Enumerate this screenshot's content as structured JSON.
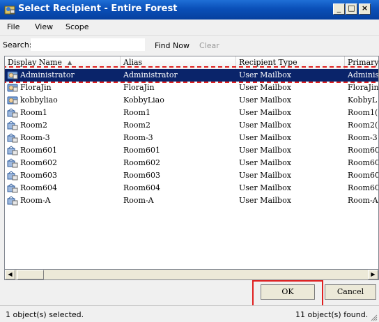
{
  "window": {
    "title": "Select Recipient - Entire Forest",
    "minimize_label": "_",
    "maximize_label": "□",
    "close_label": "×"
  },
  "menu": {
    "items": [
      "File",
      "View",
      "Scope"
    ]
  },
  "search": {
    "label": "Search:",
    "value": "",
    "find_now": "Find Now",
    "clear": "Clear"
  },
  "columns": [
    "Display Name",
    "Alias",
    "Recipient Type",
    "Primary"
  ],
  "rows": [
    {
      "display_name": "Administrator",
      "alias": "Administrator",
      "type": "User Mailbox",
      "primary": "Adminis",
      "icon": "user-mailbox-icon",
      "selected": true
    },
    {
      "display_name": "FloraJin",
      "alias": "FloraJin",
      "type": "User Mailbox",
      "primary": "FloraJin",
      "icon": "user-mailbox-icon"
    },
    {
      "display_name": "kobbyliao",
      "alias": "KobbyLiao",
      "type": "User Mailbox",
      "primary": "KobbyL",
      "icon": "user-mailbox-icon"
    },
    {
      "display_name": "Room1",
      "alias": "Room1",
      "type": "User Mailbox",
      "primary": "Room1(",
      "icon": "room-mailbox-icon"
    },
    {
      "display_name": "Room2",
      "alias": "Room2",
      "type": "User Mailbox",
      "primary": "Room2(",
      "icon": "room-mailbox-icon"
    },
    {
      "display_name": "Room-3",
      "alias": "Room-3",
      "type": "User Mailbox",
      "primary": "Room-3",
      "icon": "room-mailbox-icon"
    },
    {
      "display_name": "Room601",
      "alias": "Room601",
      "type": "User Mailbox",
      "primary": "Room60",
      "icon": "room-mailbox-icon"
    },
    {
      "display_name": "Room602",
      "alias": "Room602",
      "type": "User Mailbox",
      "primary": "Room60",
      "icon": "room-mailbox-icon"
    },
    {
      "display_name": "Room603",
      "alias": "Room603",
      "type": "User Mailbox",
      "primary": "Room60",
      "icon": "room-mailbox-icon"
    },
    {
      "display_name": "Room604",
      "alias": "Room604",
      "type": "User Mailbox",
      "primary": "Room60",
      "icon": "room-mailbox-icon"
    },
    {
      "display_name": "Room-A",
      "alias": "Room-A",
      "type": "User Mailbox",
      "primary": "Room-A",
      "icon": "room-mailbox-icon"
    }
  ],
  "buttons": {
    "ok": "OK",
    "cancel": "Cancel"
  },
  "status": {
    "left": "1 object(s) selected.",
    "right": "11 object(s) found."
  },
  "colors": {
    "selection": "#0a246a",
    "highlight": "#e02020",
    "titlebar": "#0a4fb8"
  }
}
